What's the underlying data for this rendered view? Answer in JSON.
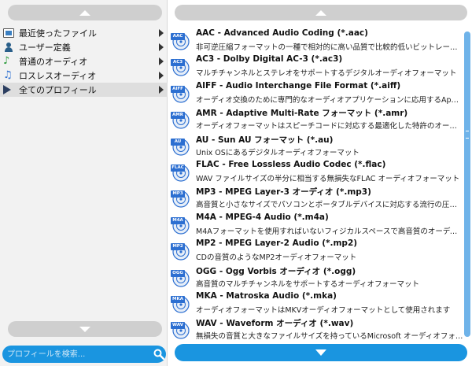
{
  "sidebar": {
    "categories": [
      {
        "label": "最近使ったファイル",
        "icon": "recent-files-icon"
      },
      {
        "label": "ユーザー定義",
        "icon": "user-icon"
      },
      {
        "label": "普通のオーディオ",
        "icon": "music-note-icon"
      },
      {
        "label": "ロスレスオーディオ",
        "icon": "lossless-note-icon"
      },
      {
        "label": "全てのプロフィール",
        "icon": "play-icon"
      }
    ],
    "selected_index": 4,
    "search_placeholder": "プロフィールを検索..."
  },
  "formats": [
    {
      "badge": "AAC",
      "name": "AAC - Advanced Audio Coding (*.aac)",
      "desc": "非可逆圧縮フォーマットの一種で相対的に高い品質で比較的低いビットレートを提供する"
    },
    {
      "badge": "AC3",
      "name": "AC3 - Dolby Digital AC-3 (*.ac3)",
      "desc": "マルチチャンネルとステレオをサポートするデジタルオーディオフォーマット"
    },
    {
      "badge": "AIFF",
      "name": "AIFF - Audio Interchange File Format (*.aiff)",
      "desc": "オーディオ交換のために専門的なオーディオアプリケーションに応用するApple Macintoshのフ..."
    },
    {
      "badge": "AMR",
      "name": "AMR - Adaptive Multi-Rate フォーマット (*.amr)",
      "desc": "オーディオフォーマットはスピーチコードに対応する最適化した特許のオーディオデータの圧縮スキーム..."
    },
    {
      "badge": "AU",
      "name": "AU - Sun AU フォーマット (*.au)",
      "desc": "Unix OSにあるデジタルオーディオフォーマット"
    },
    {
      "badge": "FLAC",
      "name": "FLAC - Free Lossless Audio Codec (*.flac)",
      "desc": "WAV ファイルサイズの半分に相当する無損失なFLAC オーディオフォーマット"
    },
    {
      "badge": "MP3",
      "name": "MP3 - MPEG Layer-3 オーディオ (*.mp3)",
      "desc": "高音質と小さなサイズでパソコンとポータブルデバイスに対応する流行の圧縮フォーマット"
    },
    {
      "badge": "M4A",
      "name": "M4A - MPEG-4 Audio (*.m4a)",
      "desc": "M4Aフォーマットを使用すればいないフィジカルスペースで高音質のオーディオを作れます"
    },
    {
      "badge": "MP2",
      "name": "MP2 - MPEG Layer-2 Audio (*.mp2)",
      "desc": "CDの音質のようなMP2オーディオフォーマット"
    },
    {
      "badge": "OGG",
      "name": "OGG - Ogg Vorbis オーディオ (*.ogg)",
      "desc": "高音質のマルチチャンネルをサポートするオーディオフォーマット"
    },
    {
      "badge": "MKA",
      "name": "MKA - Matroska Audio (*.mka)",
      "desc": "オーディオフォーマットはMKVオーディオフォーマットとして使用されます"
    },
    {
      "badge": "WAV",
      "name": "WAV - Waveform オーディオ (*.wav)",
      "desc": "無損失の音質と大きなファイルサイズを持っているMicrosoft オーディオフォーマット"
    }
  ],
  "colors": {
    "accent": "#1a95e0",
    "scroll_button": "#cfcfcf",
    "badge": "#2c6fd1"
  }
}
